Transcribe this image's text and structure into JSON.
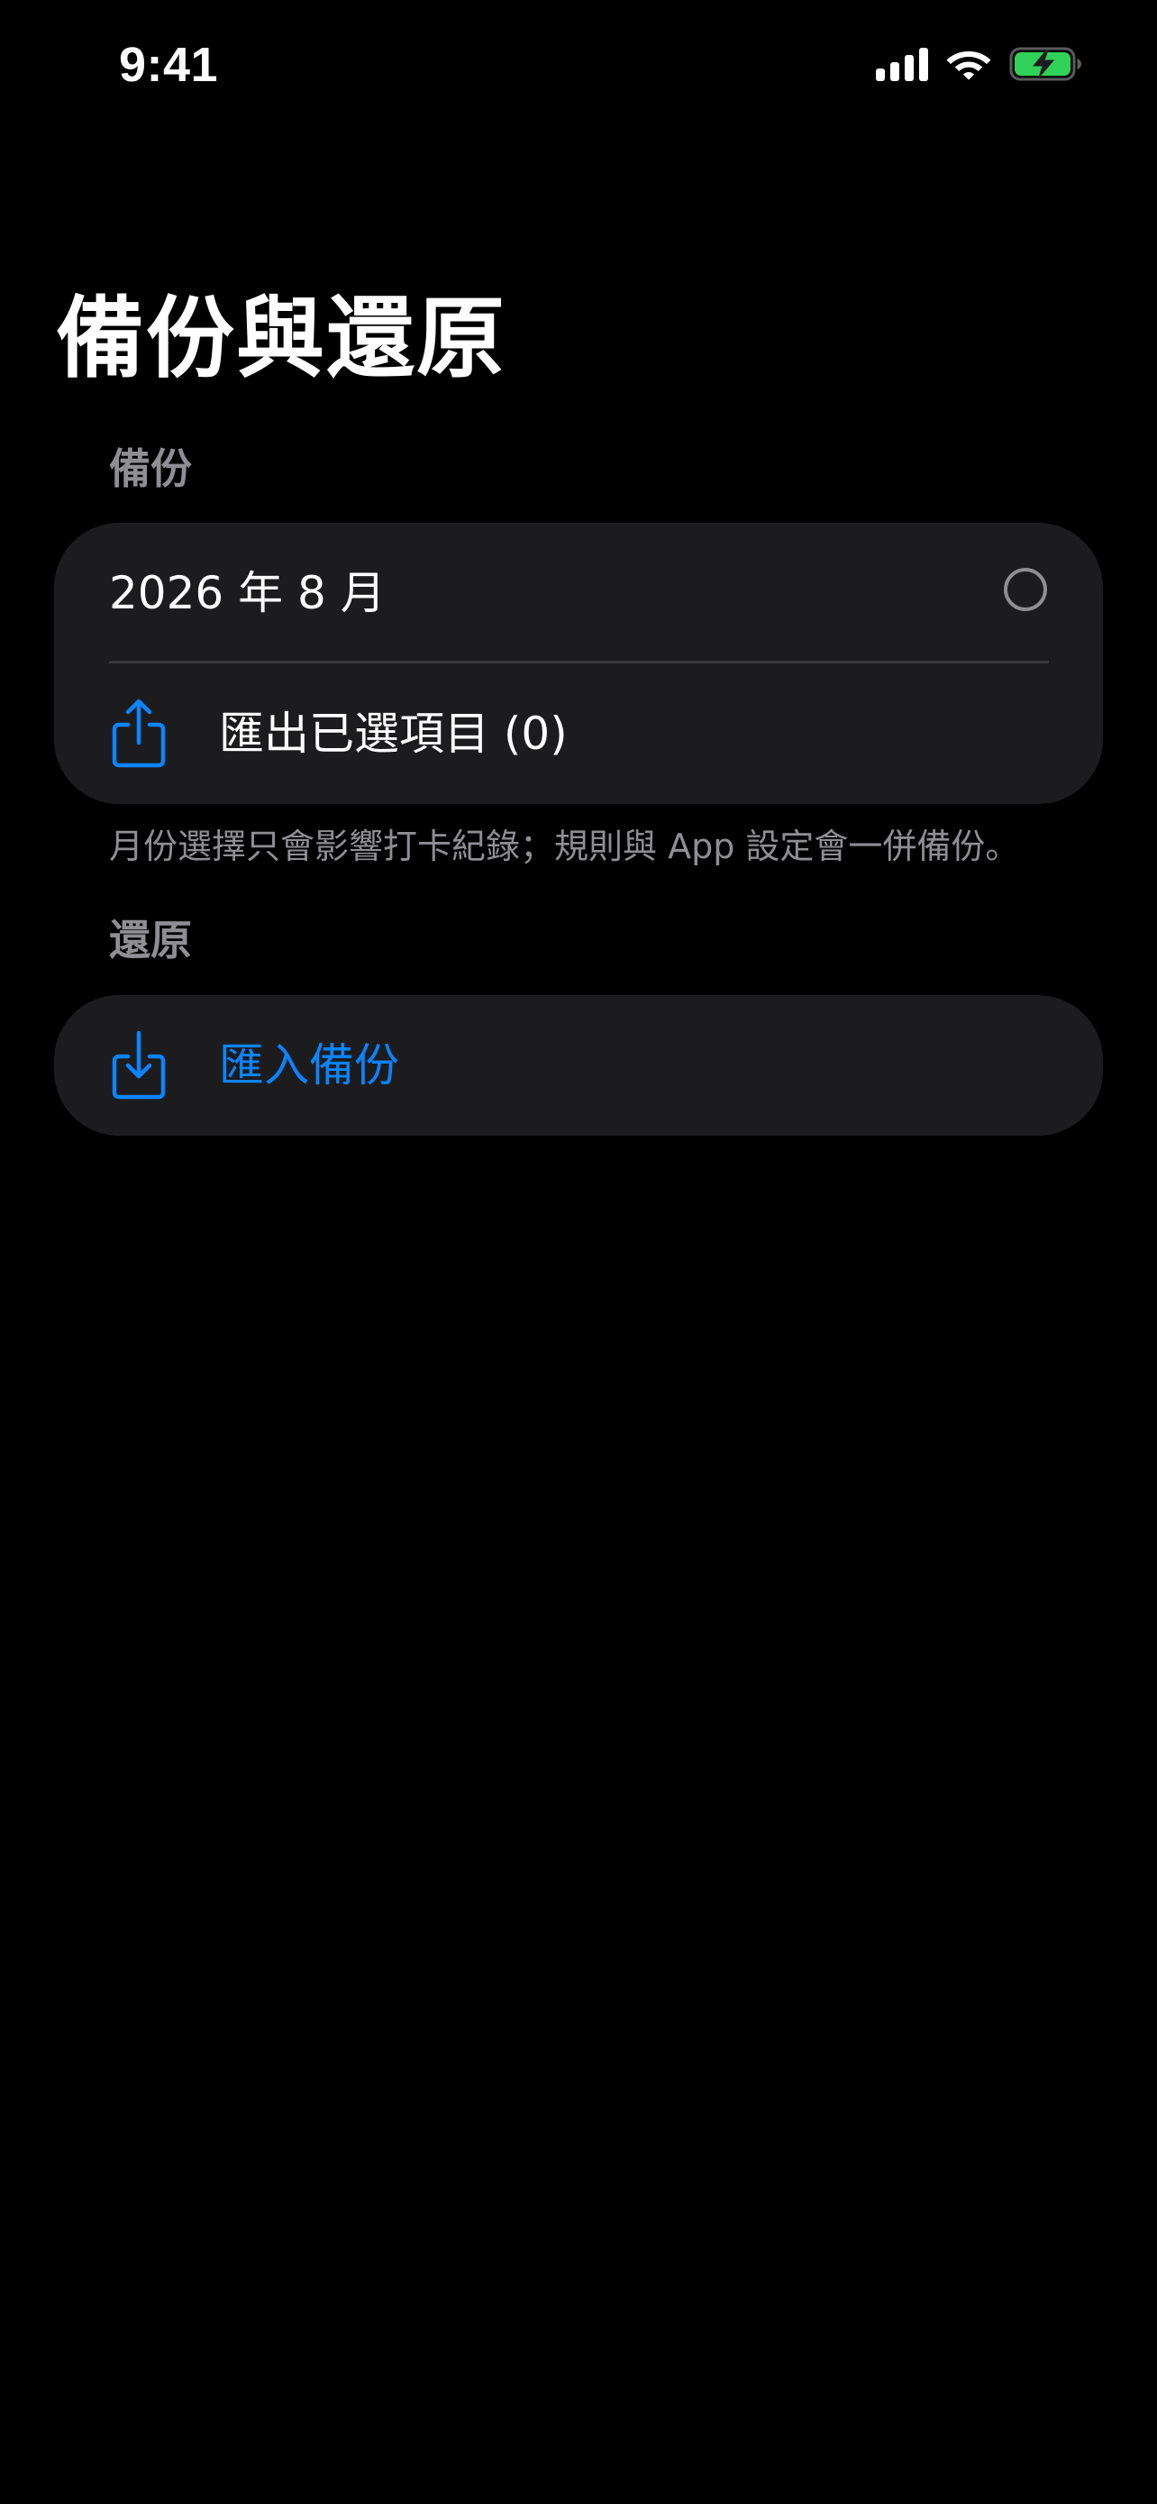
{
  "status_bar": {
    "time": "9:41",
    "icons": [
      "cellular-signal-icon",
      "wifi-icon",
      "battery-charging-icon"
    ],
    "battery_color": "#30d158"
  },
  "page": {
    "title": "備份與還原"
  },
  "backup_section": {
    "header": "備份",
    "month_item": {
      "label": "2026 年 8 月",
      "selected": false
    },
    "export_button": {
      "icon": "share-upload-icon",
      "label": "匯出已選項目 (0)"
    },
    "footnote": "月份選擇只會影響打卡紀錄；規則與 App 設定會一併備份。"
  },
  "restore_section": {
    "header": "還原",
    "import_button": {
      "icon": "import-download-icon",
      "label": "匯入備份"
    }
  },
  "colors": {
    "background": "#000000",
    "card": "#1c1c1e",
    "secondary_text": "#8e8e93",
    "accent": "#0a84ff",
    "separator": "#38383a"
  }
}
